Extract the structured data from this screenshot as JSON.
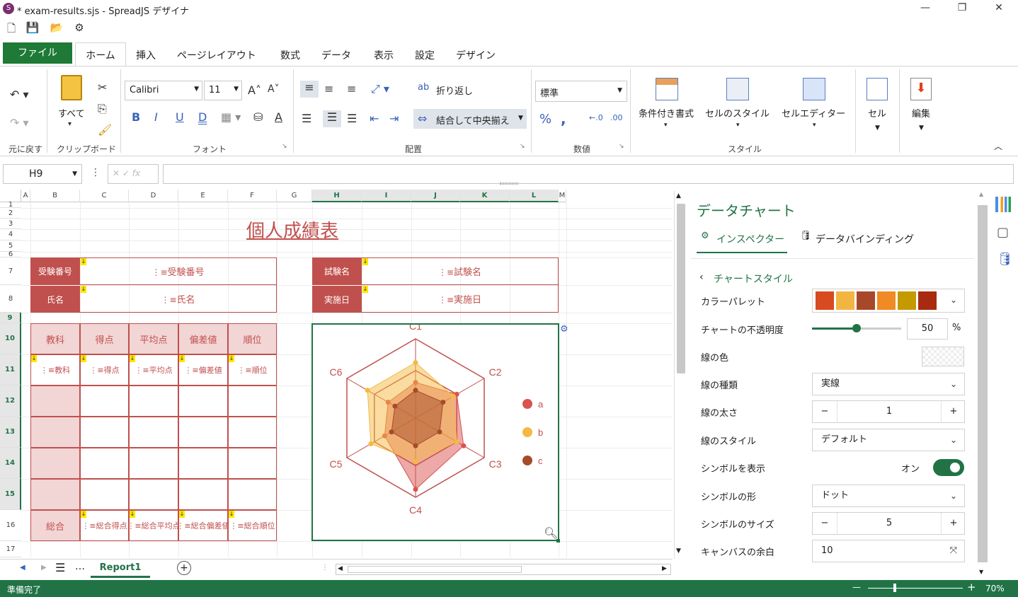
{
  "title": "* exam-results.sjs - SpreadJS デザイナ",
  "tabs": [
    "ファイル",
    "ホーム",
    "挿入",
    "ページレイアウト",
    "数式",
    "データ",
    "表示",
    "設定",
    "デザイン"
  ],
  "ribbon": {
    "undo_group": "元に戻す",
    "paste_label": "すべて",
    "clipboard_group": "クリップボード",
    "font_name": "Calibri",
    "font_size": "11",
    "font_group": "フォント",
    "wrap_label": "折り返し",
    "merge_label": "結合して中央揃え",
    "align_group": "配置",
    "number_format": "標準",
    "number_group": "数値",
    "cond_format": "条件付き書式",
    "cell_style": "セルのスタイル",
    "cell_editor": "セルエディター",
    "style_group": "スタイル",
    "cell_label": "セル",
    "edit_label": "編集"
  },
  "formula": {
    "cell_ref": "H9",
    "fx": "fx",
    "value": ""
  },
  "columns": [
    "A",
    "B",
    "C",
    "D",
    "E",
    "F",
    "G",
    "H",
    "I",
    "J",
    "K",
    "L",
    "M"
  ],
  "rows": [
    "1",
    "2",
    "3",
    "4",
    "5",
    "6",
    "7",
    "8",
    "9",
    "10",
    "11",
    "12",
    "13",
    "14",
    "15",
    "16",
    "17"
  ],
  "sheet": {
    "title": "個人成績表",
    "exam_no_label": "受験番号",
    "exam_no_bind": "受験番号",
    "name_label": "氏名",
    "name_bind": "氏名",
    "exam_name_label": "試験名",
    "exam_name_bind": "試験名",
    "date_label": "実施日",
    "date_bind": "実施日",
    "table_headers": [
      "教科",
      "得点",
      "平均点",
      "偏差値",
      "順位"
    ],
    "table_binds": [
      "教科",
      "得点",
      "平均点",
      "偏差値",
      "順位"
    ],
    "total_label": "総合",
    "total_binds": [
      "総合得点",
      "総合平均点",
      "総合偏差値",
      "総合順位"
    ]
  },
  "chart_data": {
    "type": "radar",
    "categories": [
      "C1",
      "C2",
      "C3",
      "C4",
      "C5",
      "C6"
    ],
    "series": [
      {
        "name": "a",
        "values": [
          45,
          60,
          70,
          90,
          45,
          40
        ],
        "color": "#d9534f"
      },
      {
        "name": "b",
        "values": [
          70,
          55,
          60,
          55,
          65,
          70
        ],
        "color": "#f5b942"
      },
      {
        "name": "c",
        "values": [
          35,
          40,
          35,
          35,
          35,
          30
        ],
        "color": "#a64b2a"
      }
    ],
    "rmax": 100,
    "legend": "right"
  },
  "sheet_tab": "Report1",
  "status": {
    "ready": "準備完了",
    "zoom": "70%"
  },
  "panel": {
    "title": "データチャート",
    "tab_inspector": "インスペクター",
    "tab_binding": "データバインディング",
    "back_label": "チャートスタイル",
    "palette_label": "カラーパレット",
    "palette": [
      "#d84a20",
      "#f3b542",
      "#a8482a",
      "#f08a24",
      "#c49a00",
      "#a82a10"
    ],
    "opacity_label": "チャートの不透明度",
    "opacity_value": "50",
    "opacity_unit": "%",
    "line_color_label": "線の色",
    "line_type_label": "線の種類",
    "line_type_value": "実線",
    "line_width_label": "線の太さ",
    "line_width_value": "1",
    "line_style_label": "線のスタイル",
    "line_style_value": "デフォルト",
    "show_symbol_label": "シンボルを表示",
    "show_symbol_value": "オン",
    "symbol_shape_label": "シンボルの形",
    "symbol_shape_value": "ドット",
    "symbol_size_label": "シンボルのサイズ",
    "symbol_size_value": "5",
    "canvas_margin_label": "キャンバスの余白",
    "canvas_margin_value": "10"
  }
}
